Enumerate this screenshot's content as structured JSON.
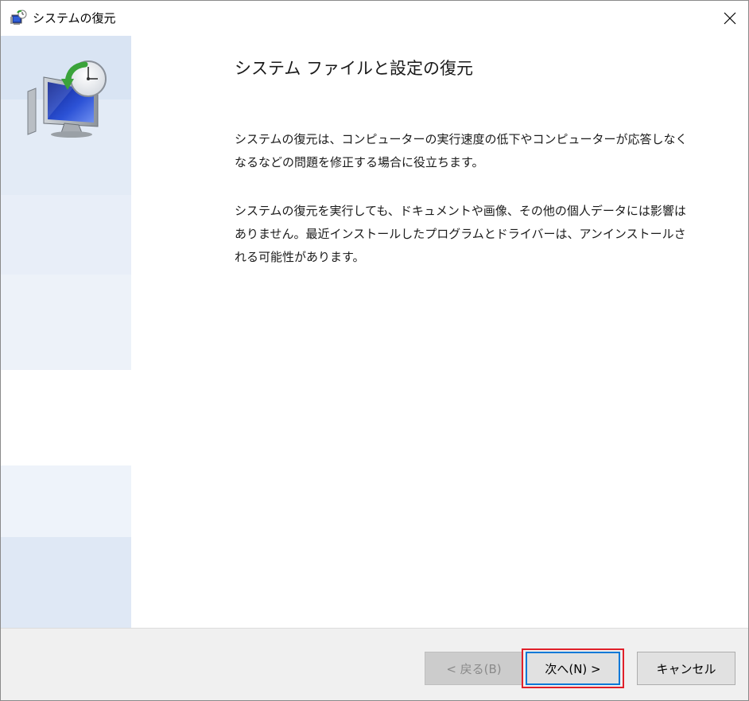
{
  "window": {
    "title": "システムの復元",
    "icon": "system-restore-icon",
    "close_icon": "close-icon"
  },
  "main": {
    "heading": "システム ファイルと設定の復元",
    "paragraph1": "システムの復元は、コンピューターの実行速度の低下やコンピューターが応答しなくなるなどの問題を修正する場合に役立ちます。",
    "paragraph2": "システムの復元を実行しても、ドキュメントや画像、その他の個人データには影響はありません。最近インストールしたプログラムとドライバーは、アンインストールされる可能性があります。"
  },
  "footer": {
    "back_label": "< 戻る(B)",
    "next_label": "次へ(N) >",
    "cancel_label": "キャンセル",
    "back_enabled": false,
    "highlight_color": "#e0202a",
    "focus_color": "#0078d7"
  },
  "colors": {
    "sidebar": "#dfe8f5",
    "footer": "#f0f0f0"
  }
}
